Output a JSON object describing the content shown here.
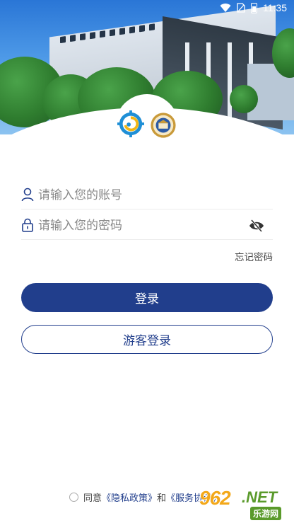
{
  "status_bar": {
    "time": "11:35",
    "icons": [
      "wifi-icon",
      "sim-icon",
      "battery-icon"
    ]
  },
  "header": {
    "image": "campus-building-photo",
    "logos": [
      "gear-emblem-logo",
      "college-seal-logo"
    ]
  },
  "login_form": {
    "username_placeholder": "请输入您的账号",
    "password_placeholder": "请输入您的密码",
    "forgot_password": "忘记密码",
    "login_button": "登录",
    "guest_button": "游客登录"
  },
  "agreement": {
    "prefix": "同意",
    "privacy_link": "《隐私政策》",
    "and": "和",
    "service_link": "《服务协议》"
  },
  "watermark": {
    "number": "962",
    "suffix": ".NET",
    "site_name": "乐游网"
  },
  "colors": {
    "primary": "#213e8c",
    "text": "#444444",
    "placeholder": "#8a8a8a"
  }
}
